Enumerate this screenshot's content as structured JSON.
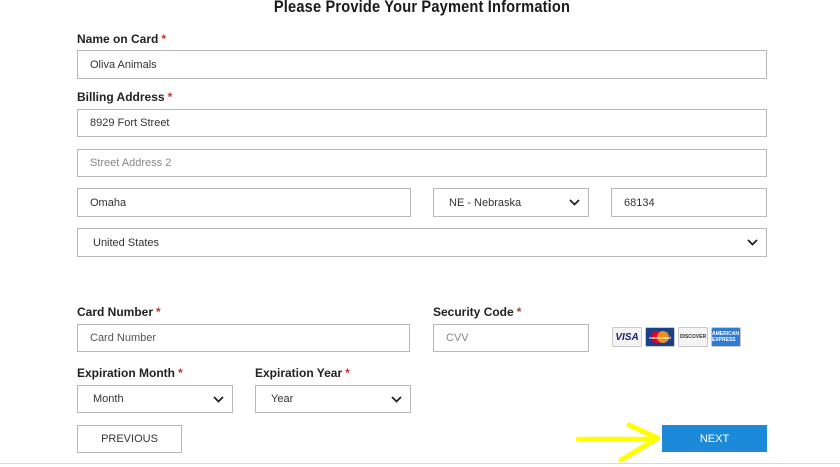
{
  "page_title": "Please Provide Your Payment Information",
  "name_on_card": {
    "label": "Name on Card",
    "required": "*",
    "value": "Oliva Animals"
  },
  "billing_address": {
    "label": "Billing Address",
    "required": "*",
    "street1": "8929 Fort Street",
    "street2_placeholder": "Street Address 2",
    "city": "Omaha",
    "state": "NE - Nebraska",
    "zip": "68134",
    "country": "United States"
  },
  "card_number": {
    "label": "Card Number",
    "required": "*",
    "placeholder": "Card Number"
  },
  "security_code": {
    "label": "Security Code",
    "required": "*",
    "placeholder": "CVV"
  },
  "card_logos": {
    "visa": "VISA",
    "mastercard": "mastercard",
    "discover": "DISCOVER",
    "amex": "AMERICAN EXPRESS"
  },
  "expiration_month": {
    "label": "Expiration Month",
    "required": "*",
    "value": "Month"
  },
  "expiration_year": {
    "label": "Expiration Year",
    "required": "*",
    "value": "Year"
  },
  "buttons": {
    "previous": "PREVIOUS",
    "next": "NEXT"
  },
  "colors": {
    "next_button": "#1c8ad9",
    "required_mark": "#c0392b",
    "arrow": "#ffff00"
  }
}
